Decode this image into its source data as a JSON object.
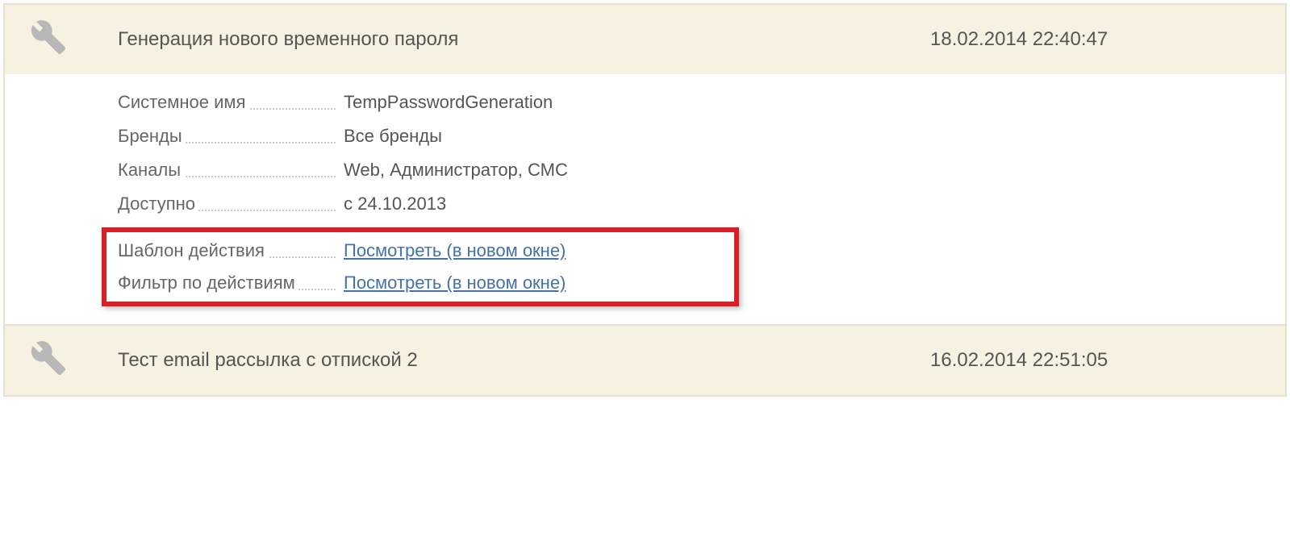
{
  "items": [
    {
      "title": "Генерация нового временного пароля",
      "date": "18.02.2014 22:40:47"
    },
    {
      "title": "Тест email рассылка с отпиской 2",
      "date": "16.02.2014 22:51:05"
    }
  ],
  "details": {
    "system_name_label": "Системное имя",
    "system_name_value": "TempPasswordGeneration",
    "brands_label": "Бренды",
    "brands_value": "Все бренды",
    "channels_label": "Каналы",
    "channels_value": "Web, Администратор, СМС",
    "available_label": "Доступно",
    "available_value": "с 24.10.2013",
    "action_template_label": "Шаблон действия",
    "action_template_link": "Посмотреть (в новом окне)",
    "action_filter_label": "Фильтр по действиям",
    "action_filter_link": "Посмотреть (в новом окне)"
  }
}
